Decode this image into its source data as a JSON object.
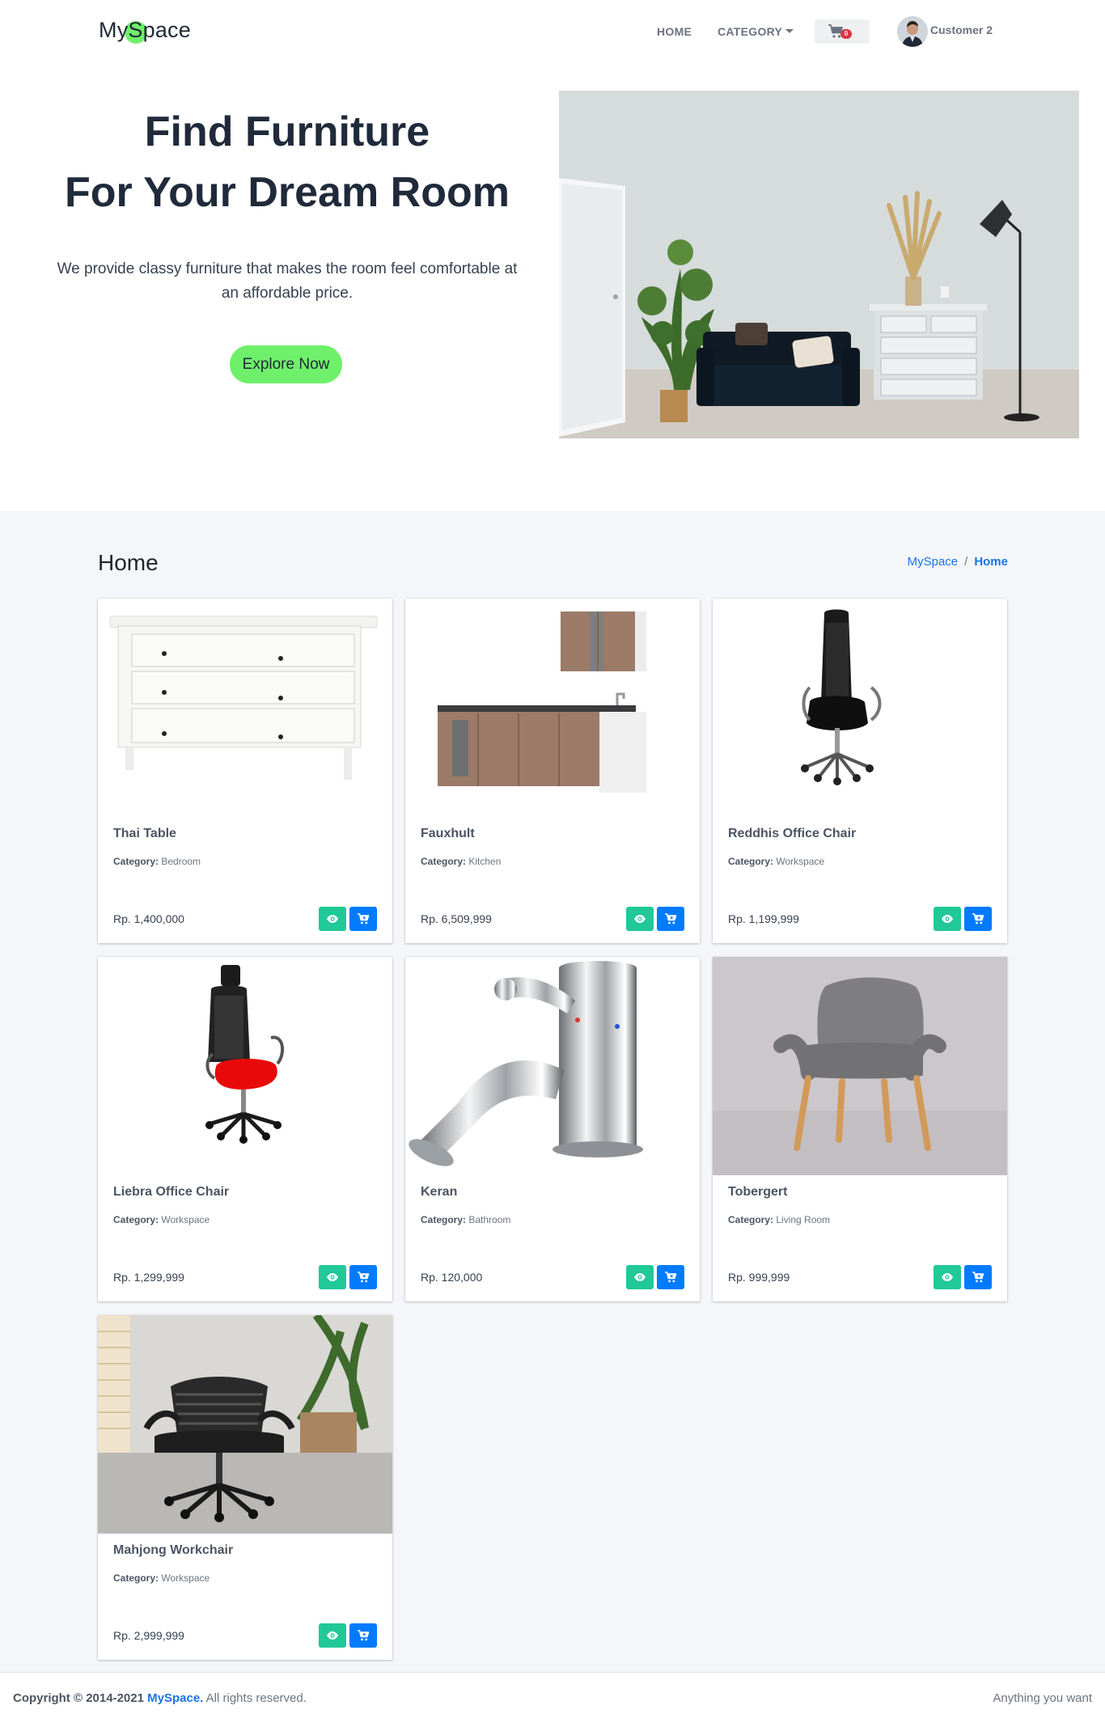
{
  "brand": {
    "name": "MySpace"
  },
  "nav": {
    "home": "HOME",
    "category": "CATEGORY",
    "cart_count": "0",
    "username": "Customer 2"
  },
  "hero": {
    "title_line1": "Find Furniture",
    "title_line2": "For Your Dream Room",
    "description": "We provide classy furniture that makes the room feel comfortable at an affordable price.",
    "cta": "Explore Now"
  },
  "page": {
    "title": "Home",
    "breadcrumb": [
      "MySpace",
      "Home"
    ]
  },
  "product_labels": {
    "category_prefix": "Category:"
  },
  "products": [
    {
      "name": "Thai Table",
      "category": "Bedroom",
      "price": "Rp. 1,400,000"
    },
    {
      "name": "Fauxhult",
      "category": "Kitchen",
      "price": "Rp. 6,509,999"
    },
    {
      "name": "Reddhis Office Chair",
      "category": "Workspace",
      "price": "Rp. 1,199,999"
    },
    {
      "name": "Liebra Office Chair",
      "category": "Workspace",
      "price": "Rp. 1,299,999"
    },
    {
      "name": "Keran",
      "category": "Bathroom",
      "price": "Rp. 120,000"
    },
    {
      "name": "Tobergert",
      "category": "Living Room",
      "price": "Rp. 999,999"
    },
    {
      "name": "Mahjong Workchair",
      "category": "Workspace",
      "price": "Rp. 2,999,999"
    }
  ],
  "footer": {
    "copyright": "Copyright © 2014-2021",
    "brand": "MySpace.",
    "rights": "All rights reserved.",
    "right_text": "Anything you want"
  },
  "colors": {
    "accent_green": "#6ff06a",
    "view_button": "#20c997",
    "cart_button": "#007bff",
    "badge": "#dc3545",
    "link": "#1a73e8"
  }
}
